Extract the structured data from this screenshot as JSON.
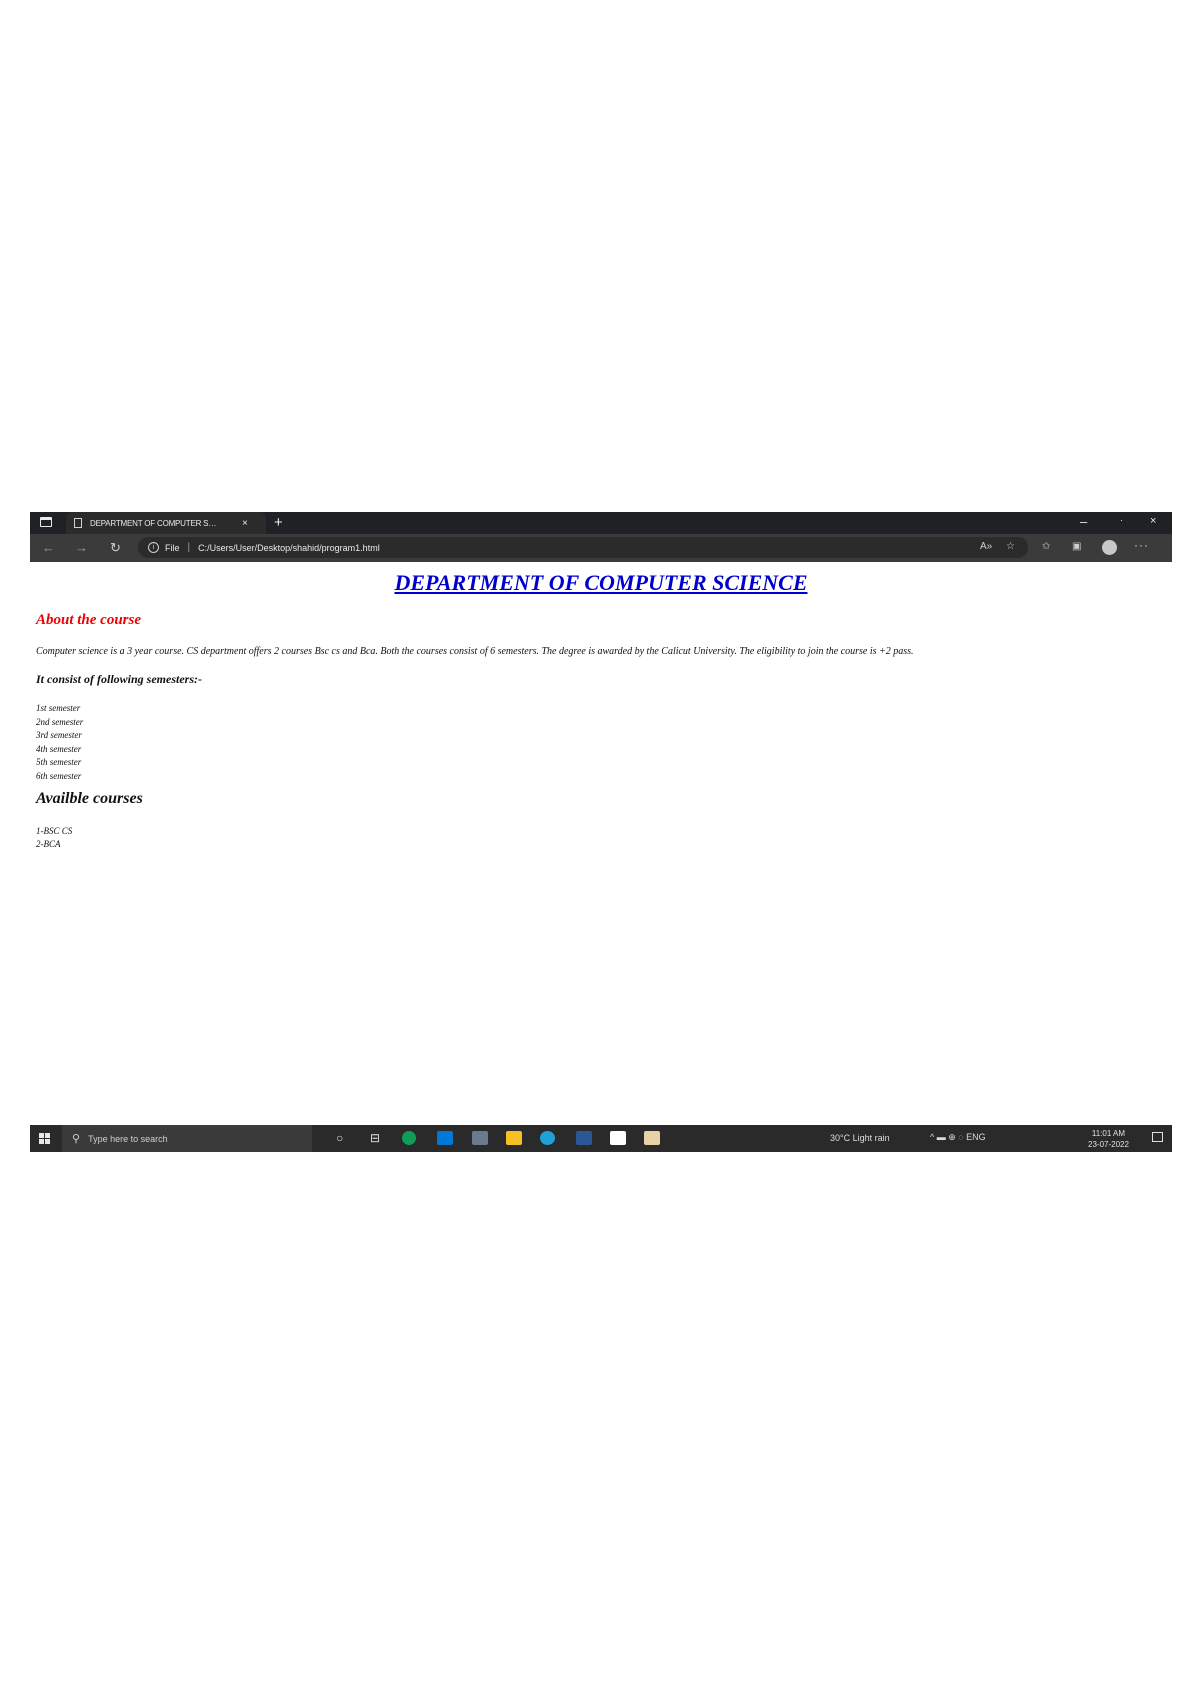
{
  "browser": {
    "tab_title": "DEPARTMENT OF COMPUTER S…",
    "tab_close": "×",
    "new_tab": "+",
    "window_controls": {
      "minimize": "–",
      "maximize": "·",
      "close": "×"
    },
    "address": {
      "scheme_label": "File",
      "separator": "|",
      "url": "C:/Users/User/Desktop/shahid/program1.html"
    },
    "icons": [
      "back-icon",
      "forward-icon",
      "refresh-icon",
      "info-icon",
      "read-aloud-icon",
      "favorite-icon",
      "favorites-icon",
      "collections-icon",
      "profile-icon",
      "more-icon"
    ]
  },
  "page": {
    "heading": "DEPARTMENT OF COMPUTER SCIENCE",
    "about_heading": "About the course",
    "paragraph": "Computer science is a 3 year course. CS department offers 2 courses Bsc cs and Bca. Both the courses consist of 6 semesters. The degree is awarded by the Calicut University. The eligibility to join the course is +2 pass.",
    "consist_heading": "It consist of following semesters:-",
    "semesters": [
      "1st semester",
      "2nd semester",
      "3rd semester",
      "4th semester",
      "5th semester",
      "6th semester"
    ],
    "courses_heading": "Availble courses",
    "courses": [
      "1-BSC CS",
      "2-BCA"
    ]
  },
  "taskbar": {
    "search_placeholder": "Type here to search",
    "weather": "30°C Light rain",
    "tray": "^ ▬ ⊕ ◌ ENG",
    "time": "11:01 AM",
    "date": "23-07-2022",
    "colors": {
      "chrome": "#0f9d58",
      "mail": "#0078d4",
      "explorer": "#f4c025",
      "edge": "#1fa0d8",
      "word": "#2b5797",
      "store": "#ffffff",
      "paint": "#e8d2a6"
    }
  },
  "colors": {
    "heading": "#0000cc",
    "about": "#ee0000",
    "tabbar": "#202124",
    "taskbar": "#2a2a2a"
  }
}
